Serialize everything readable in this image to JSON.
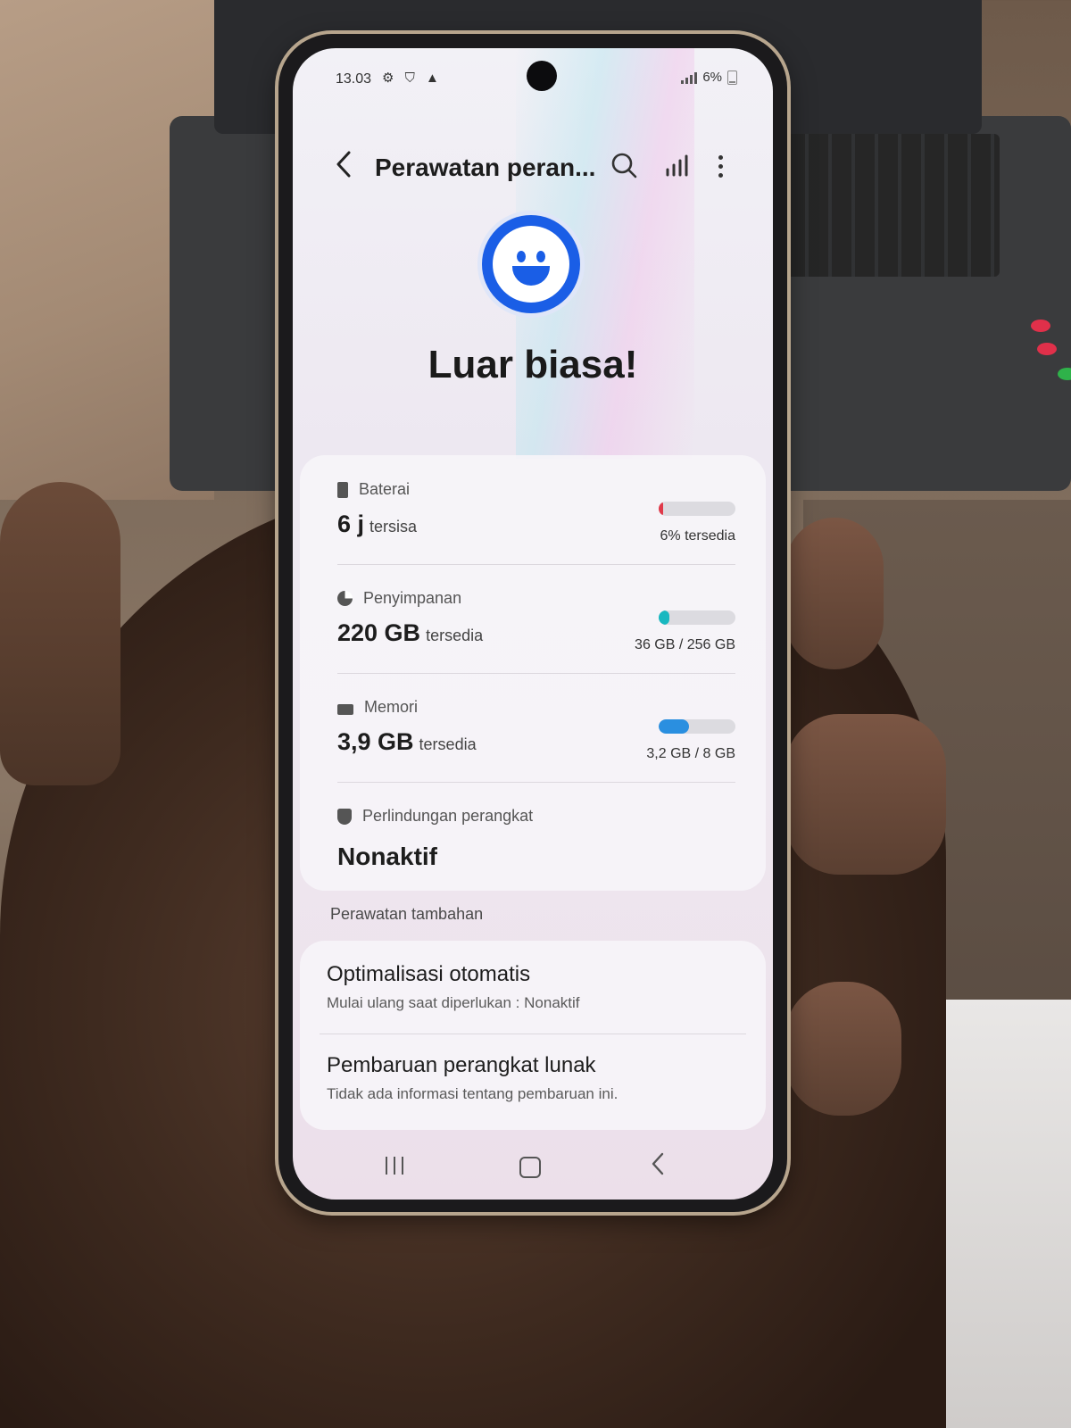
{
  "status_bar": {
    "time": "13.03",
    "icons": "⚙ ⛉ ▲",
    "battery_percent": "6%"
  },
  "app_bar": {
    "title": "Perawatan peran...",
    "back_icon": "chevron-left-icon",
    "search_icon": "search-icon",
    "chart_icon": "bar-chart-icon",
    "more_icon": "more-vert-icon"
  },
  "hero": {
    "face_icon": "smiley-face-icon",
    "headline": "Luar biasa!",
    "accent_color": "#1a5ee6"
  },
  "status": {
    "battery": {
      "label": "Baterai",
      "value": "6 j",
      "value_suffix": "tersisa",
      "caption": "6% tersedia",
      "level": 0.06,
      "color": "#e03a4a"
    },
    "storage": {
      "label": "Penyimpanan",
      "value": "220 GB",
      "value_suffix": "tersedia",
      "caption": "36 GB / 256 GB",
      "level": 0.14,
      "color": "#18b8c0"
    },
    "memory": {
      "label": "Memori",
      "value": "3,9 GB",
      "value_suffix": "tersedia",
      "caption": "3,2 GB / 8 GB",
      "level": 0.4,
      "color": "#2a8fe0"
    },
    "protection": {
      "label": "Perlindungan perangkat",
      "value": "Nonaktif"
    }
  },
  "extra": {
    "section_title": "Perawatan tambahan",
    "items": [
      {
        "title": "Optimalisasi otomatis",
        "desc": "Mulai ulang saat diperlukan : Nonaktif"
      },
      {
        "title": "Pembaruan perangkat lunak",
        "desc": "Tidak ada informasi tentang pembaruan ini."
      }
    ]
  },
  "navbar": {
    "recent_icon": "recent-apps-icon",
    "home_icon": "home-icon",
    "back_icon": "back-icon"
  }
}
